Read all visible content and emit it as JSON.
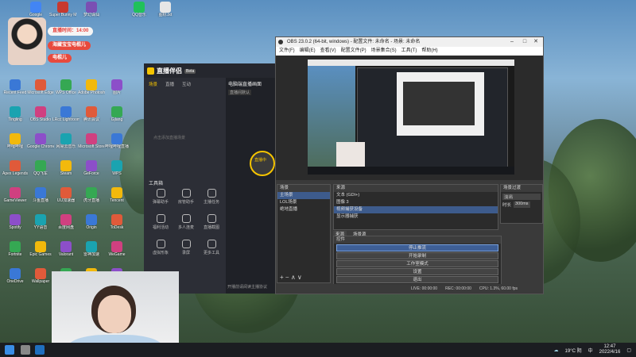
{
  "top_shortcuts": [
    {
      "label": "Google",
      "color": "#4285f4"
    },
    {
      "label": "Super Bunny Man",
      "color": "#c7392f"
    },
    {
      "label": "梦幻诛仙",
      "color": "#7a4fb3"
    },
    {
      "label": "QQ音乐",
      "color": "#20c15a"
    },
    {
      "label": "图标.txt",
      "color": "#e6e6e6"
    }
  ],
  "widget": {
    "timer": "直播时间：14:00",
    "badge1": "海藏宝宝电棍儿",
    "badge2": "电棍儿"
  },
  "desktop_icons": [
    "Recent Feed",
    "Microsoft Edge",
    "WPS Office",
    "Adobe Photoshop",
    "图片",
    "Tingling",
    "OBS Studio",
    "LRcc Lightroom",
    "腾讯会议",
    "Gjlang",
    "哔哩哔哩",
    "Google Chrome",
    "网易云音乐",
    "Microsoft Store",
    "哔哩哔哩直播",
    "Apex Legends",
    "QQ飞车",
    "Steam",
    "GeForce",
    "WPS",
    "GameViewer",
    "斗鱼直播",
    "UU加速器",
    "虎牙直播",
    "Tencent",
    "Spotify",
    "YY语音",
    "百度网盘",
    "Origin",
    "ToDesk",
    "Fortnite",
    "Epic Games",
    "Valorant",
    "雷神加速",
    "WeGame",
    "OneDrive",
    "Wallpaper",
    "Discord",
    "Clash",
    "Steam"
  ],
  "zhibo": {
    "brand": "直播伴侣",
    "version": "Beta",
    "tabs": [
      "场景",
      "直播",
      "互动"
    ],
    "title": "电脑端直播画面",
    "subtitle": "直播间默认",
    "hint": "点击添加直播场景",
    "tools_title": "工具箱",
    "tools": [
      "弹幕助手",
      "房管助手",
      "主播任务",
      "福利活动",
      "多人连麦",
      "直播截图",
      "虚拟形象",
      "录屏",
      "更多工具"
    ],
    "right_label": "直播中",
    "footer": "开播前请阅读主播协议"
  },
  "obs": {
    "title": "OBS 23.0.2 (64-bit, windows) - 配置文件: 未命名 - 场景: 未命名",
    "menu": [
      "文件(F)",
      "编辑(E)",
      "查看(V)",
      "配置文件(P)",
      "场景集合(S)",
      "工具(T)",
      "帮助(H)"
    ],
    "scenes_header": "场景",
    "scenes": [
      "主场景",
      "LOL场景",
      "绝地直播"
    ],
    "sources_header": "来源",
    "sources": [
      "文本 (GDI+)",
      "图像 3",
      "视频捕获设备",
      "显示器捕获"
    ],
    "mixer_header": "音频混音器",
    "mixer_tabs": [
      "来源",
      "场景源"
    ],
    "transitions_header": "场景过渡",
    "transition_type": "淡出",
    "duration_label": "时长",
    "duration": "300ms",
    "controls_header": "控件",
    "controls": [
      "停止推流",
      "开始录制",
      "工作室模式",
      "设置",
      "退出"
    ],
    "status": {
      "live": "LIVE: 00:00:00",
      "rec": "REC: 00:00:00",
      "cpu": "CPU: 1.3%, 60.00 fps"
    }
  },
  "taskbar": {
    "weather": "19°C 阴",
    "lang": "中",
    "time": "12:47",
    "date": "2022/4/16"
  }
}
